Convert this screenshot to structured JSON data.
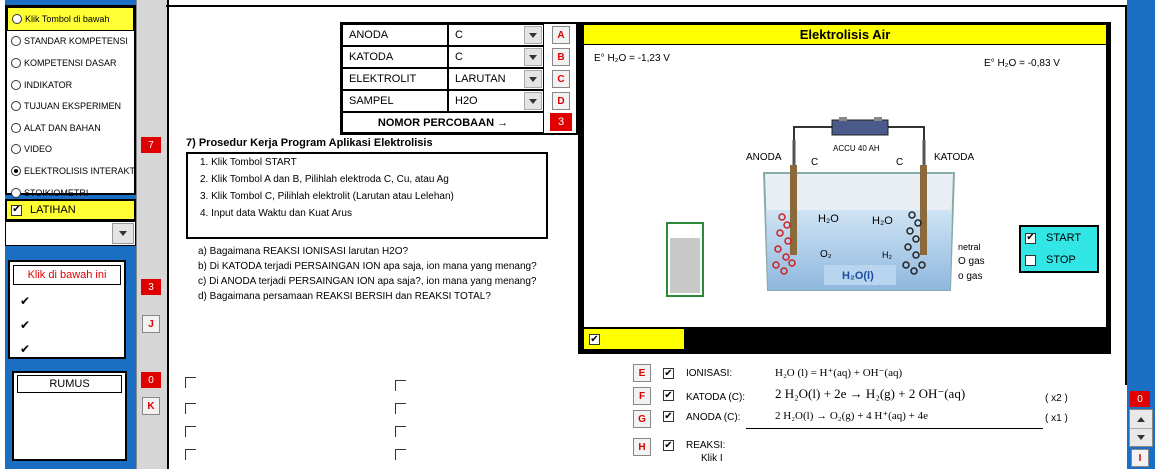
{
  "menu": {
    "items": [
      {
        "label": "Klik Tombol di bawah",
        "selected": false
      },
      {
        "label": "STANDAR KOMPETENSI",
        "selected": false
      },
      {
        "label": "KOMPETENSI DASAR",
        "selected": false
      },
      {
        "label": "INDIKATOR",
        "selected": false
      },
      {
        "label": "TUJUAN EKSPERIMEN",
        "selected": false
      },
      {
        "label": "ALAT DAN BAHAN",
        "selected": false
      },
      {
        "label": "VIDEO",
        "selected": false
      },
      {
        "label": "ELEKTROLISIS INTERAKTIF",
        "selected": true
      },
      {
        "label": "STOIKIOMETRI",
        "selected": false
      }
    ],
    "counter": "7"
  },
  "latihan": {
    "label": "LATIHAN",
    "checked": true,
    "combo_value": ""
  },
  "klik_panel": {
    "title": "Klik di bawah ini",
    "counter": "3",
    "button": "J"
  },
  "rumus": {
    "title": "RUMUS",
    "counter": "0",
    "button": "K"
  },
  "table": {
    "rows": [
      {
        "label": "ANODA",
        "value": "C",
        "button": "A"
      },
      {
        "label": "KATODA",
        "value": "C",
        "button": "B"
      },
      {
        "label": "ELEKTROLIT",
        "value": "LARUTAN",
        "button": "C"
      },
      {
        "label": "SAMPEL",
        "value": "H2O",
        "button": "D"
      }
    ],
    "nomor_label": "NOMOR PERCOBAAN →",
    "nomor_value": "3"
  },
  "procedure": {
    "title": "7) Prosedur Kerja Program Aplikasi Elektrolisis",
    "steps": [
      "1. Klik Tombol START",
      "2. Klik Tombol A dan B, Pilihlah elektroda C, Cu, atau Ag",
      "3. Klik Tombol C, Pilihlah elektrolit (Larutan atau Lelehan)",
      "4. Input data Waktu dan Kuat Arus"
    ],
    "questions": [
      "a) Bagaimana REAKSI IONISASI larutan H2O?",
      "b) Di KATODA terjadi PERSAINGAN ION  apa saja, ion mana yang menang?",
      "c) Di ANODA terjadi PERSAINGAN ION apa saja?, ion mana yang menang?",
      "d) Bagaimana  persamaan REAKSI BERSIH dan REAKSI TOTAL?"
    ]
  },
  "sim": {
    "title": "Elektrolisis Air",
    "e_left": "E° H₂O = -1,23 V",
    "e_right": "E° H₂O = -0,83 V",
    "accu": "ACCU 40 AH",
    "anoda": "ANODA",
    "katoda": "KATODA",
    "c_left": "C",
    "c_right": "C",
    "h2o_left": "H₂O",
    "o2": "O₂",
    "h2o_right": "H₂O",
    "h2": "H₂",
    "liquid": "H₂O(l)",
    "side_notes": [
      "netral",
      "O gas",
      "o gas"
    ],
    "start": "START",
    "stop": "STOP",
    "start_checked": true,
    "stop_checked": false,
    "footer_checked": true
  },
  "reactions": [
    {
      "button": "E",
      "checked": true,
      "label": "IONISASI:",
      "equation": "H₂O (l) = H⁺(aq) + OH⁻(aq)",
      "factor": ""
    },
    {
      "button": "F",
      "checked": true,
      "label": "KATODA (C):",
      "equation": "2 H₂O(l) + 2e → H₂(g) + 2 OH⁻(aq)",
      "factor": "( x2 )"
    },
    {
      "button": "G",
      "checked": true,
      "label": "ANODA (C):",
      "equation": "2 H₂O(l) → O₂(g) + 4 H⁺(aq) + 4e",
      "factor": "( x1 )"
    },
    {
      "button": "H",
      "checked": true,
      "label": "REAKSI:",
      "equation": "Klik I",
      "factor": ""
    }
  ],
  "right_panel": {
    "counter": "0",
    "button": "I"
  }
}
